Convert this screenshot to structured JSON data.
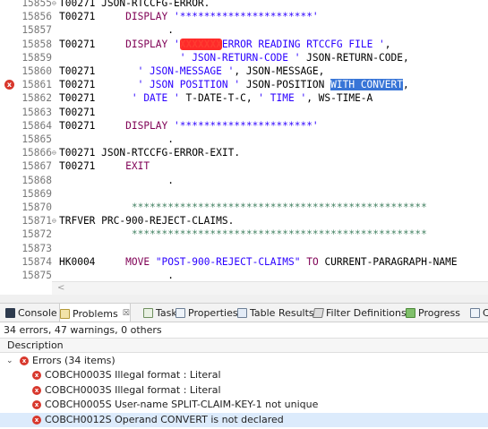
{
  "editor": {
    "lines": [
      {
        "num": "15855",
        "fold": "⊖",
        "tag": "T00271",
        "code": [
          {
            "t": " JSON-RTCCFG-ERROR.",
            "c": ""
          }
        ]
      },
      {
        "num": "15856",
        "fold": "",
        "tag": "T00271",
        "code": [
          {
            "t": "     ",
            "c": ""
          },
          {
            "t": "DISPLAY",
            "c": "kw"
          },
          {
            "t": " ",
            "c": ""
          },
          {
            "t": "'**********************'",
            "c": "str"
          }
        ]
      },
      {
        "num": "15857",
        "fold": "",
        "tag": "",
        "code": [
          {
            "t": "            .",
            "c": ""
          }
        ]
      },
      {
        "num": "15858",
        "fold": "",
        "tag": "T00271",
        "code": [
          {
            "t": "     ",
            "c": ""
          },
          {
            "t": "DISPLAY",
            "c": "kw"
          },
          {
            "t": " ",
            "c": ""
          },
          {
            "t": "'",
            "c": "str"
          },
          {
            "t": "XXXXXXX",
            "c": "redact"
          },
          {
            "t": "ERROR READING RTCCFG FILE '",
            "c": "str"
          },
          {
            "t": ",",
            "c": ""
          }
        ]
      },
      {
        "num": "15859",
        "fold": "",
        "tag": "",
        "code": [
          {
            "t": "              ",
            "c": ""
          },
          {
            "t": "' JSON-RETURN-CODE '",
            "c": "str"
          },
          {
            "t": " JSON-RETURN-CODE,",
            "c": ""
          }
        ]
      },
      {
        "num": "15860",
        "fold": "",
        "tag": "T00271",
        "code": [
          {
            "t": "       ",
            "c": ""
          },
          {
            "t": "' JSON-MESSAGE '",
            "c": "str"
          },
          {
            "t": ", JSON-MESSAGE,",
            "c": ""
          }
        ]
      },
      {
        "num": "15861",
        "fold": "",
        "tag": "T00271",
        "error": true,
        "code": [
          {
            "t": "       ",
            "c": ""
          },
          {
            "t": "' JSON POSITION '",
            "c": "str"
          },
          {
            "t": " JSON-POSITION ",
            "c": ""
          },
          {
            "t": "WITH CONVERT",
            "c": "hl"
          },
          {
            "t": ",",
            "c": ""
          }
        ]
      },
      {
        "num": "15862",
        "fold": "",
        "tag": "T00271",
        "code": [
          {
            "t": "      ",
            "c": ""
          },
          {
            "t": "' DATE '",
            "c": "str"
          },
          {
            "t": " T-DATE-T-C, ",
            "c": ""
          },
          {
            "t": "' TIME '",
            "c": "str"
          },
          {
            "t": ", WS-TIME-A",
            "c": ""
          }
        ]
      },
      {
        "num": "15863",
        "fold": "",
        "tag": "T00271",
        "code": []
      },
      {
        "num": "15864",
        "fold": "",
        "tag": "T00271",
        "code": [
          {
            "t": "     ",
            "c": ""
          },
          {
            "t": "DISPLAY",
            "c": "kw"
          },
          {
            "t": " ",
            "c": ""
          },
          {
            "t": "'**********************'",
            "c": "str"
          }
        ]
      },
      {
        "num": "15865",
        "fold": "",
        "tag": "",
        "code": [
          {
            "t": "            .",
            "c": ""
          }
        ]
      },
      {
        "num": "15866",
        "fold": "⊖",
        "tag": "T00271",
        "code": [
          {
            "t": " JSON-RTCCFG-ERROR-EXIT.",
            "c": ""
          }
        ]
      },
      {
        "num": "15867",
        "fold": "",
        "tag": "T00271",
        "code": [
          {
            "t": "     ",
            "c": ""
          },
          {
            "t": "EXIT",
            "c": "kw"
          }
        ]
      },
      {
        "num": "15868",
        "fold": "",
        "tag": "",
        "code": [
          {
            "t": "            .",
            "c": ""
          }
        ]
      },
      {
        "num": "15869",
        "fold": "",
        "tag": "",
        "code": []
      },
      {
        "num": "15870",
        "fold": "",
        "tag": "",
        "code": [
          {
            "t": "      ",
            "c": ""
          },
          {
            "t": "*************************************************",
            "c": "cmt"
          }
        ]
      },
      {
        "num": "15871",
        "fold": "⊖",
        "tag": "TRFVER",
        "code": [
          {
            "t": " PRC-900-REJECT-CLAIMS.",
            "c": ""
          }
        ]
      },
      {
        "num": "15872",
        "fold": "",
        "tag": "",
        "code": [
          {
            "t": "      ",
            "c": ""
          },
          {
            "t": "*************************************************",
            "c": "cmt"
          }
        ]
      },
      {
        "num": "15873",
        "fold": "",
        "tag": "",
        "code": []
      },
      {
        "num": "15874",
        "fold": "",
        "tag": "HK0004",
        "code": [
          {
            "t": "     ",
            "c": ""
          },
          {
            "t": "MOVE",
            "c": "kw"
          },
          {
            "t": " ",
            "c": ""
          },
          {
            "t": "\"POST-900-REJECT-CLAIMS\"",
            "c": "str"
          },
          {
            "t": " ",
            "c": ""
          },
          {
            "t": "TO",
            "c": "kw"
          },
          {
            "t": " CURRENT-PARAGRAPH-NAME",
            "c": ""
          }
        ]
      },
      {
        "num": "15875",
        "fold": "",
        "tag": "",
        "code": [
          {
            "t": "            .",
            "c": ""
          }
        ]
      },
      {
        "num": "15876",
        "fold": "",
        "tag": "",
        "code": []
      }
    ]
  },
  "hscroll": {
    "left_arrow": "<"
  },
  "tabs": [
    {
      "label": "Console",
      "icon": "console-icon",
      "cls": "console",
      "active": false
    },
    {
      "label": "Problems",
      "icon": "problems-icon",
      "cls": "problems",
      "active": true,
      "close": "☒"
    },
    {
      "label": "Tasks",
      "icon": "tasks-icon",
      "cls": "tasks",
      "active": false
    },
    {
      "label": "Properties",
      "icon": "properties-icon",
      "cls": "props",
      "active": false
    },
    {
      "label": "Table Results",
      "icon": "table-results-icon",
      "cls": "table",
      "active": false
    },
    {
      "label": "Filter Definitions",
      "icon": "filter-icon",
      "cls": "filter",
      "active": false
    },
    {
      "label": "Progress",
      "icon": "progress-icon",
      "cls": "progress",
      "active": false
    },
    {
      "label": "Co",
      "icon": "overflow-icon",
      "cls": "props",
      "active": false
    }
  ],
  "problems": {
    "summary": "34 errors, 47 warnings, 0 others",
    "column_description": "Description",
    "group": {
      "twisty": "⌄",
      "label": "Errors (34 items)"
    },
    "items": [
      {
        "label": "COBCH0003S Illegal format : Literal",
        "selected": false
      },
      {
        "label": "COBCH0003S Illegal format : Literal",
        "selected": false
      },
      {
        "label": "COBCH0005S User-name SPLIT-CLAIM-KEY-1 not unique",
        "selected": false
      },
      {
        "label": "COBCH0012S Operand CONVERT is not declared",
        "selected": true
      }
    ]
  }
}
